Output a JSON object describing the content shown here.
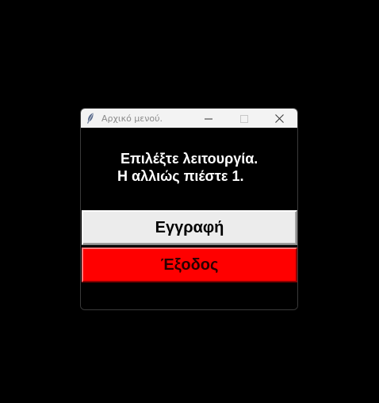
{
  "window": {
    "title": "Αρχικό μενού.",
    "icon": "feather-icon"
  },
  "title_controls": {
    "minimize_icon": "minimize-icon",
    "maximize_icon": "maximize-icon",
    "close_icon": "close-icon"
  },
  "prompt": {
    "line1": "Επιλέξτε λειτουργία.",
    "line2": "Η αλλιώς πιέστε 1."
  },
  "buttons": {
    "register_label": "Εγγραφή",
    "exit_label": "Έξοδος"
  },
  "colors": {
    "background": "#000000",
    "register_button": "#ececec",
    "exit_button": "#ff0000",
    "title_bar": "#f3f3f3"
  }
}
